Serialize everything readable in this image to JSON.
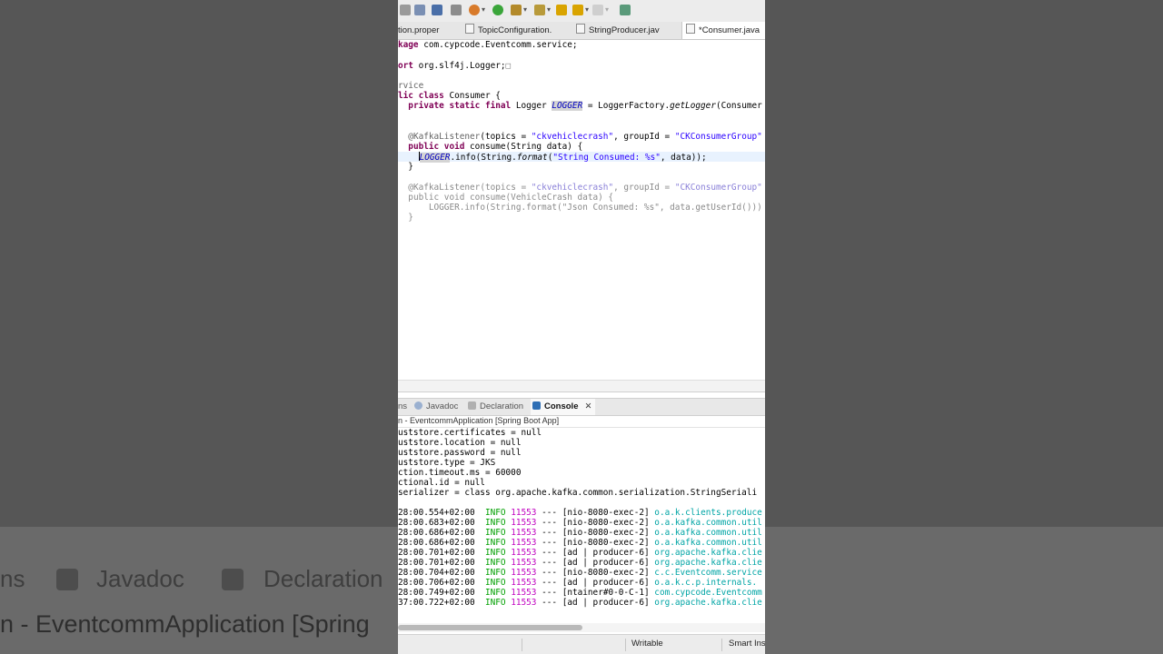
{
  "background": {
    "bg_tabs": [
      "ns",
      "Javadoc",
      "Declaration"
    ],
    "bg_title": "n - EventcommApplication [Spring"
  },
  "editor": {
    "tabs": [
      {
        "label": "tion.proper"
      },
      {
        "label": "TopicConfiguration."
      },
      {
        "label": "StringProducer.jav"
      },
      {
        "label": "*Consumer.java",
        "close": "✕"
      }
    ],
    "lines": {
      "l1": {
        "a": "kage",
        "b": " com.cypcode.Eventcomm.service;"
      },
      "l2": {
        "a": "ort",
        "b": " org.slf4j.Logger;"
      },
      "l3": {
        "a": "rvice"
      },
      "l4": {
        "a": "lic class",
        "b": " Consumer {"
      },
      "l5": {
        "a": "private static final",
        "b": " Logger ",
        "c": "LOGGER",
        "d": " = LoggerFactory.",
        "e": "getLogger",
        "f": "(Consumer"
      },
      "l6": {
        "a": "@KafkaListener",
        "b": "(topics = ",
        "c": "\"ckvehiclecrash\"",
        "d": ", groupId = ",
        "e": "\"CKConsumerGroup\""
      },
      "l7": {
        "a": "public void",
        "b": " consume(String data) {"
      },
      "l8": {
        "a": "LOGGER",
        "b": ".info(String.",
        "c": "format",
        "d": "(",
        "e": "\"String Consumed: %s\"",
        "f": ", data));"
      },
      "l9": {
        "a": "}"
      },
      "l10": {
        "a": "@KafkaListener",
        "b": "(topics = ",
        "c": "\"ckvehiclecrash\"",
        "d": ", groupId = ",
        "e": "\"CKConsumerGroup\""
      },
      "l11": {
        "a": "public void consume(VehicleCrash data) {"
      },
      "l12": {
        "a": "LOGGER.info(String.format(\"Json Consumed: %s\", data.getUserId()))"
      },
      "l13": {
        "a": "}"
      }
    }
  },
  "panel": {
    "tabs": {
      "problems": "ns",
      "javadoc": "Javadoc",
      "declaration": "Declaration",
      "console": "Console",
      "console_close": "✕"
    },
    "console_title": "n - EventcommApplication [Spring Boot App]",
    "config_lines": [
      "uststore.certificates = null",
      "uststore.location = null",
      "uststore.password = null",
      "uststore.type = JKS",
      "ction.timeout.ms = 60000",
      "ctional.id = null",
      "serializer = class org.apache.kafka.common.serialization.StringSeriali"
    ],
    "log_lines": [
      {
        "time": "28:00.554+02:00",
        "level": "INFO",
        "pid": "11553",
        "sep": "---",
        "thread": "[nio-8080-exec-2]",
        "logger": "o.a.k.clients.produce"
      },
      {
        "time": "28:00.683+02:00",
        "level": "INFO",
        "pid": "11553",
        "sep": "---",
        "thread": "[nio-8080-exec-2]",
        "logger": "o.a.kafka.common.util"
      },
      {
        "time": "28:00.686+02:00",
        "level": "INFO",
        "pid": "11553",
        "sep": "---",
        "thread": "[nio-8080-exec-2]",
        "logger": "o.a.kafka.common.util"
      },
      {
        "time": "28:00.686+02:00",
        "level": "INFO",
        "pid": "11553",
        "sep": "---",
        "thread": "[nio-8080-exec-2]",
        "logger": "o.a.kafka.common.util"
      },
      {
        "time": "28:00.701+02:00",
        "level": "INFO",
        "pid": "11553",
        "sep": "---",
        "thread": "[ad | producer-6]",
        "logger": "org.apache.kafka.clie"
      },
      {
        "time": "28:00.701+02:00",
        "level": "INFO",
        "pid": "11553",
        "sep": "---",
        "thread": "[ad | producer-6]",
        "logger": "org.apache.kafka.clie"
      },
      {
        "time": "28:00.704+02:00",
        "level": "INFO",
        "pid": "11553",
        "sep": "---",
        "thread": "[nio-8080-exec-2]",
        "logger": "c.c.Eventcomm.service"
      },
      {
        "time": "28:00.706+02:00",
        "level": "INFO",
        "pid": "11553",
        "sep": "---",
        "thread": "[ad | producer-6]",
        "logger": "o.a.k.c.p.internals."
      },
      {
        "time": "28:00.749+02:00",
        "level": "INFO",
        "pid": "11553",
        "sep": "---",
        "thread": "[ntainer#0-0-C-1]",
        "logger": "com.cypcode.Eventcomm"
      },
      {
        "time": "37:00.722+02:00",
        "level": "INFO",
        "pid": "11553",
        "sep": "---",
        "thread": "[ad | producer-6]",
        "logger": "org.apache.kafka.clie"
      }
    ]
  },
  "statusbar": {
    "writable": "Writable",
    "insert_mode": "Smart Ins"
  }
}
